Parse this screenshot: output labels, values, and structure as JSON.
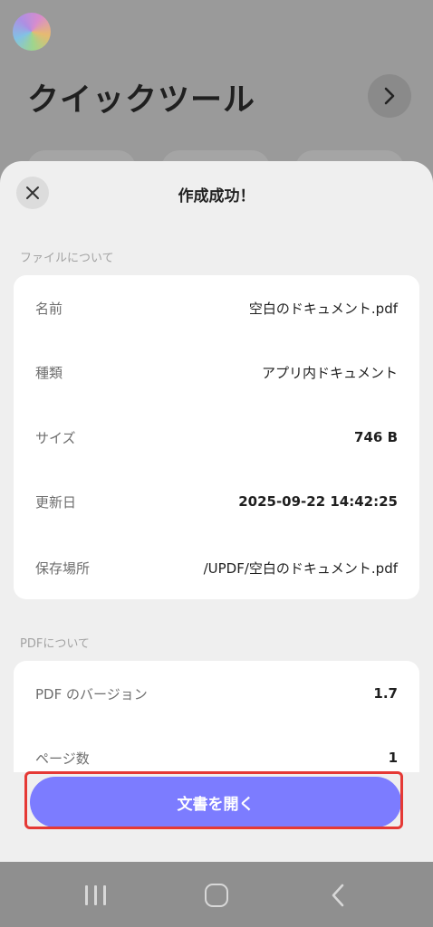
{
  "background": {
    "title": "クイックツール"
  },
  "dialog": {
    "title": "作成成功！",
    "file_section_label": "ファイルについて",
    "file_info": [
      {
        "key": "名前",
        "value": "空白のドキュメント.pdf"
      },
      {
        "key": "種類",
        "value": "アプリ内ドキュメント"
      },
      {
        "key": "サイズ",
        "value": "746 B"
      },
      {
        "key": "更新日",
        "value": "2025-09-22 14:42:25"
      },
      {
        "key": "保存場所",
        "value": "/UPDF/空白のドキュメント.pdf"
      }
    ],
    "pdf_section_label": "PDFについて",
    "pdf_info": [
      {
        "key": "PDF のバージョン",
        "value": "1.7"
      },
      {
        "key": "ページ数",
        "value": "1"
      }
    ],
    "open_button_label": "文書を開く"
  },
  "colors": {
    "accent": "#7c7cff",
    "highlight": "#e53935"
  },
  "icons": {
    "close": "close-icon",
    "next": "chevron-right-icon",
    "nav_recents": "recents-icon",
    "nav_home": "home-icon",
    "nav_back": "back-icon"
  }
}
